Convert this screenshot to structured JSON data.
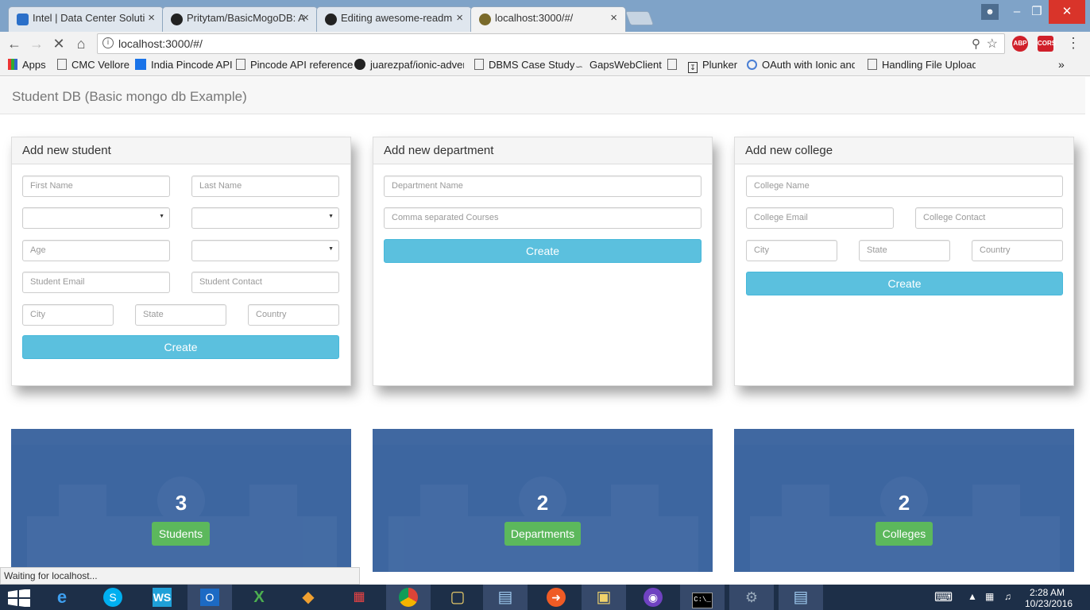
{
  "browser": {
    "tabs": [
      {
        "title": "Intel | Data Center Soluti",
        "favicon": "intel-icon",
        "color": "#2a6fc9"
      },
      {
        "title": "Pritytam/BasicMogoDB: A",
        "favicon": "github-icon",
        "color": "#222222"
      },
      {
        "title": "Editing awesome-readm",
        "favicon": "github-icon",
        "color": "#222222"
      },
      {
        "title": "localhost:3000/#/",
        "favicon": "loading-icon",
        "color": "#7a6a2a"
      }
    ],
    "url": "localhost:3000/#/",
    "extensions": [
      "ABP",
      "CORS"
    ],
    "status_text": "Waiting for localhost..."
  },
  "bookmarks": [
    {
      "label": "Apps",
      "icon": "apps-grid-icon"
    },
    {
      "label": "CMC Vellore",
      "icon": "page-icon"
    },
    {
      "label": "India Pincode API",
      "icon": "blue-square-icon"
    },
    {
      "label": "Pincode API reference",
      "icon": "page-icon"
    },
    {
      "label": "juarezpaf/ionic-adven",
      "icon": "github-icon"
    },
    {
      "label": "DBMS Case Study",
      "icon": "page-icon"
    },
    {
      "label": "GapsWebClient",
      "icon": "feather-icon"
    },
    {
      "label": "",
      "icon": "page-icon"
    },
    {
      "label": "Plunker",
      "icon": "download-icon"
    },
    {
      "label": "OAuth with Ionic and",
      "icon": "circle-icon"
    },
    {
      "label": "Handling File Uploads",
      "icon": "page-icon"
    }
  ],
  "app": {
    "brand": "Student DB (Basic mongo db Example)",
    "student_form": {
      "heading": "Add new student",
      "first_name": "First Name",
      "last_name": "Last Name",
      "age": "Age",
      "email": "Student Email",
      "contact": "Student Contact",
      "city": "City",
      "state": "State",
      "country": "Country",
      "create": "Create"
    },
    "department_form": {
      "heading": "Add new department",
      "name": "Department Name",
      "courses": "Comma separated Courses",
      "create": "Create"
    },
    "college_form": {
      "heading": "Add new college",
      "name": "College Name",
      "email": "College Email",
      "contact": "College Contact",
      "city": "City",
      "state": "State",
      "country": "Country",
      "create": "Create"
    },
    "stats": [
      {
        "count": "3",
        "label": "Students"
      },
      {
        "count": "2",
        "label": "Departments"
      },
      {
        "count": "2",
        "label": "Colleges"
      }
    ]
  },
  "taskbar": {
    "apps": [
      "windows-start-icon",
      "internet-explorer-icon",
      "skype-icon",
      "webstorm-icon",
      "outlook-icon",
      "xampp-icon",
      "git-icon",
      "apps-icon",
      "chrome-icon",
      "files-icon",
      "notepad-icon",
      "postman-icon",
      "explorer-icon",
      "github-desktop-icon",
      "cmd-icon",
      "tool-icon",
      "notepad2-icon"
    ],
    "time": "2:28 AM",
    "date": "10/23/2016"
  },
  "colors": {
    "primary_info": "#5bc0de",
    "success": "#5cb85c",
    "stat_bg": "#3d66a0"
  }
}
